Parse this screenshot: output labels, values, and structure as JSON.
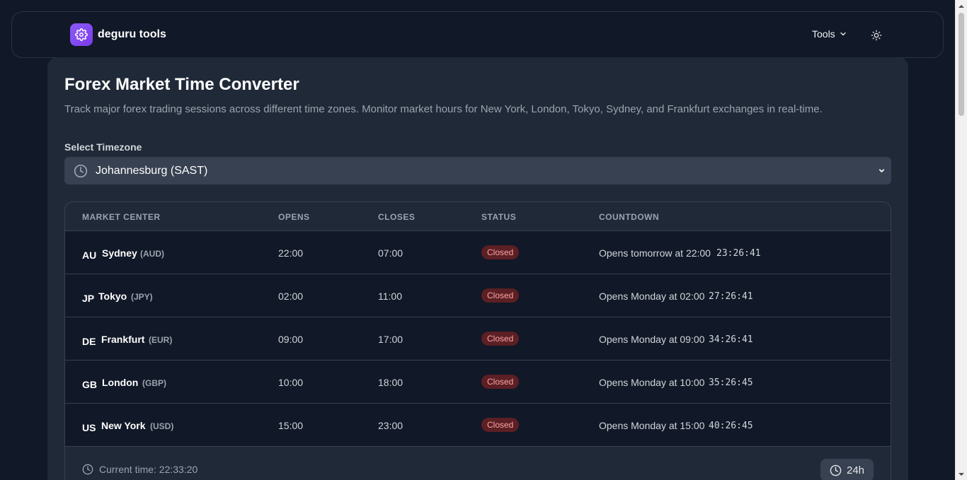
{
  "brand": {
    "name": "deguru tools",
    "logo_icon": "gear-icon",
    "logo_color": "#8b5cf6"
  },
  "nav": {
    "tools_label": "Tools",
    "theme_icon": "sun-icon"
  },
  "page": {
    "title": "Forex Market Time Converter",
    "description": "Track major forex trading sessions across different time zones. Monitor market hours for New York, London, Tokyo, Sydney, and Frankfurt exchanges in real-time."
  },
  "timezone": {
    "label": "Select Timezone",
    "selected": "Johannesburg (SAST)"
  },
  "table": {
    "headers": [
      "MARKET CENTER",
      "OPENS",
      "CLOSES",
      "STATUS",
      "COUNTDOWN"
    ],
    "rows": [
      {
        "code": "AU",
        "city": "Sydney",
        "currency": "(AUD)",
        "opens": "22:00",
        "closes": "07:00",
        "status": "Closed",
        "countdown_text": "Opens tomorrow at 22:00",
        "countdown_timer": "23:26:41"
      },
      {
        "code": "JP",
        "city": "Tokyo",
        "currency": "(JPY)",
        "opens": "02:00",
        "closes": "11:00",
        "status": "Closed",
        "countdown_text": "Opens Monday at 02:00",
        "countdown_timer": "27:26:41"
      },
      {
        "code": "DE",
        "city": "Frankfurt",
        "currency": "(EUR)",
        "opens": "09:00",
        "closes": "17:00",
        "status": "Closed",
        "countdown_text": "Opens Monday at 09:00",
        "countdown_timer": "34:26:41"
      },
      {
        "code": "GB",
        "city": "London",
        "currency": "(GBP)",
        "opens": "10:00",
        "closes": "18:00",
        "status": "Closed",
        "countdown_text": "Opens Monday at 10:00",
        "countdown_timer": "35:26:45"
      },
      {
        "code": "US",
        "city": "New York",
        "currency": "(USD)",
        "opens": "15:00",
        "closes": "23:00",
        "status": "Closed",
        "countdown_text": "Opens Monday at 15:00",
        "countdown_timer": "40:26:45"
      }
    ]
  },
  "footer": {
    "current_time": "Current time: 22:33:20",
    "format_button": "24h"
  },
  "colors": {
    "background": "#111827",
    "card": "#1f2937",
    "closed_badge_bg": "#5b1f24",
    "closed_badge_text": "#fca5a5"
  }
}
